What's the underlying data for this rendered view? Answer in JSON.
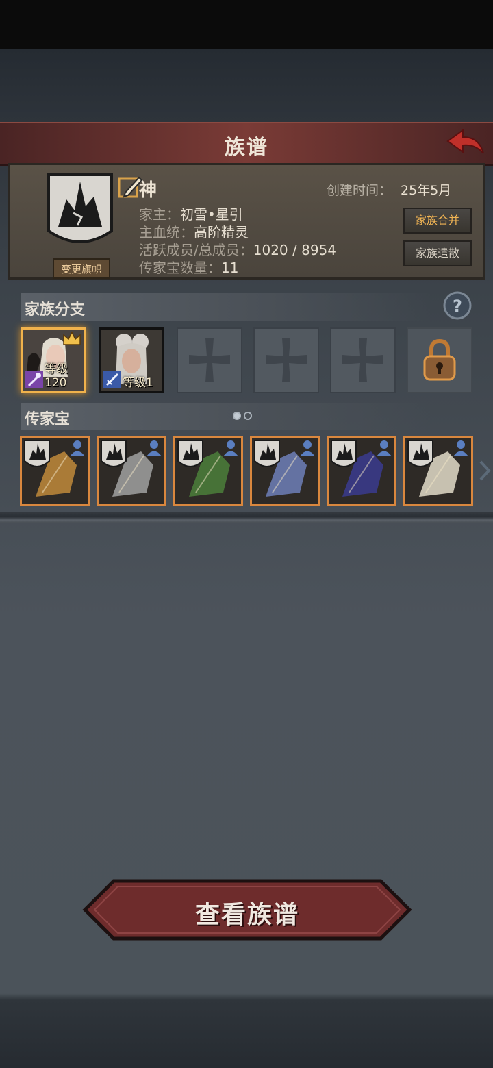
{
  "header": {
    "title": "族谱"
  },
  "family": {
    "name": "神",
    "change_banner_label": "变更旗帜",
    "created_label": "创建时间：",
    "created_value": "25年5月",
    "leader_label": "家主：",
    "leader_value": "初雪•星引",
    "bloodline_label": "主血统：",
    "bloodline_value": "高阶精灵",
    "members_label": "活跃成员/总成员：",
    "members_value": "1020 / 8954",
    "heirloom_count_label": "传家宝数量：",
    "heirloom_count_value": "11",
    "merge_button": "家族合并",
    "disband_button": "家族遣散"
  },
  "branches": {
    "title": "家族分支",
    "heroes": [
      {
        "level": "等级120",
        "active": true,
        "class_icon": "staff-icon",
        "crown": true
      },
      {
        "level": "等级1",
        "active": false,
        "class_icon": "sword-icon",
        "crown": false
      }
    ],
    "empty_slots": 3,
    "locked_slots": 1
  },
  "heirlooms": {
    "title": "传家宝",
    "page": 1,
    "pages": 2,
    "items": [
      {
        "name": "golden-staff",
        "color": "#b8843a"
      },
      {
        "name": "silver-crossblade",
        "color": "#9a9a9a"
      },
      {
        "name": "green-leaf-armor",
        "color": "#4a7a3a"
      },
      {
        "name": "ornate-shield",
        "color": "#6a7ab0"
      },
      {
        "name": "violet-armor",
        "color": "#3a3a8a"
      },
      {
        "name": "bone-blade",
        "color": "#d8d2c0"
      }
    ]
  },
  "footer": {
    "view_button": "查看族谱"
  },
  "colors": {
    "accent": "#f0b24c",
    "title_bar": "#7a3b36",
    "frame": "#d9873e"
  }
}
